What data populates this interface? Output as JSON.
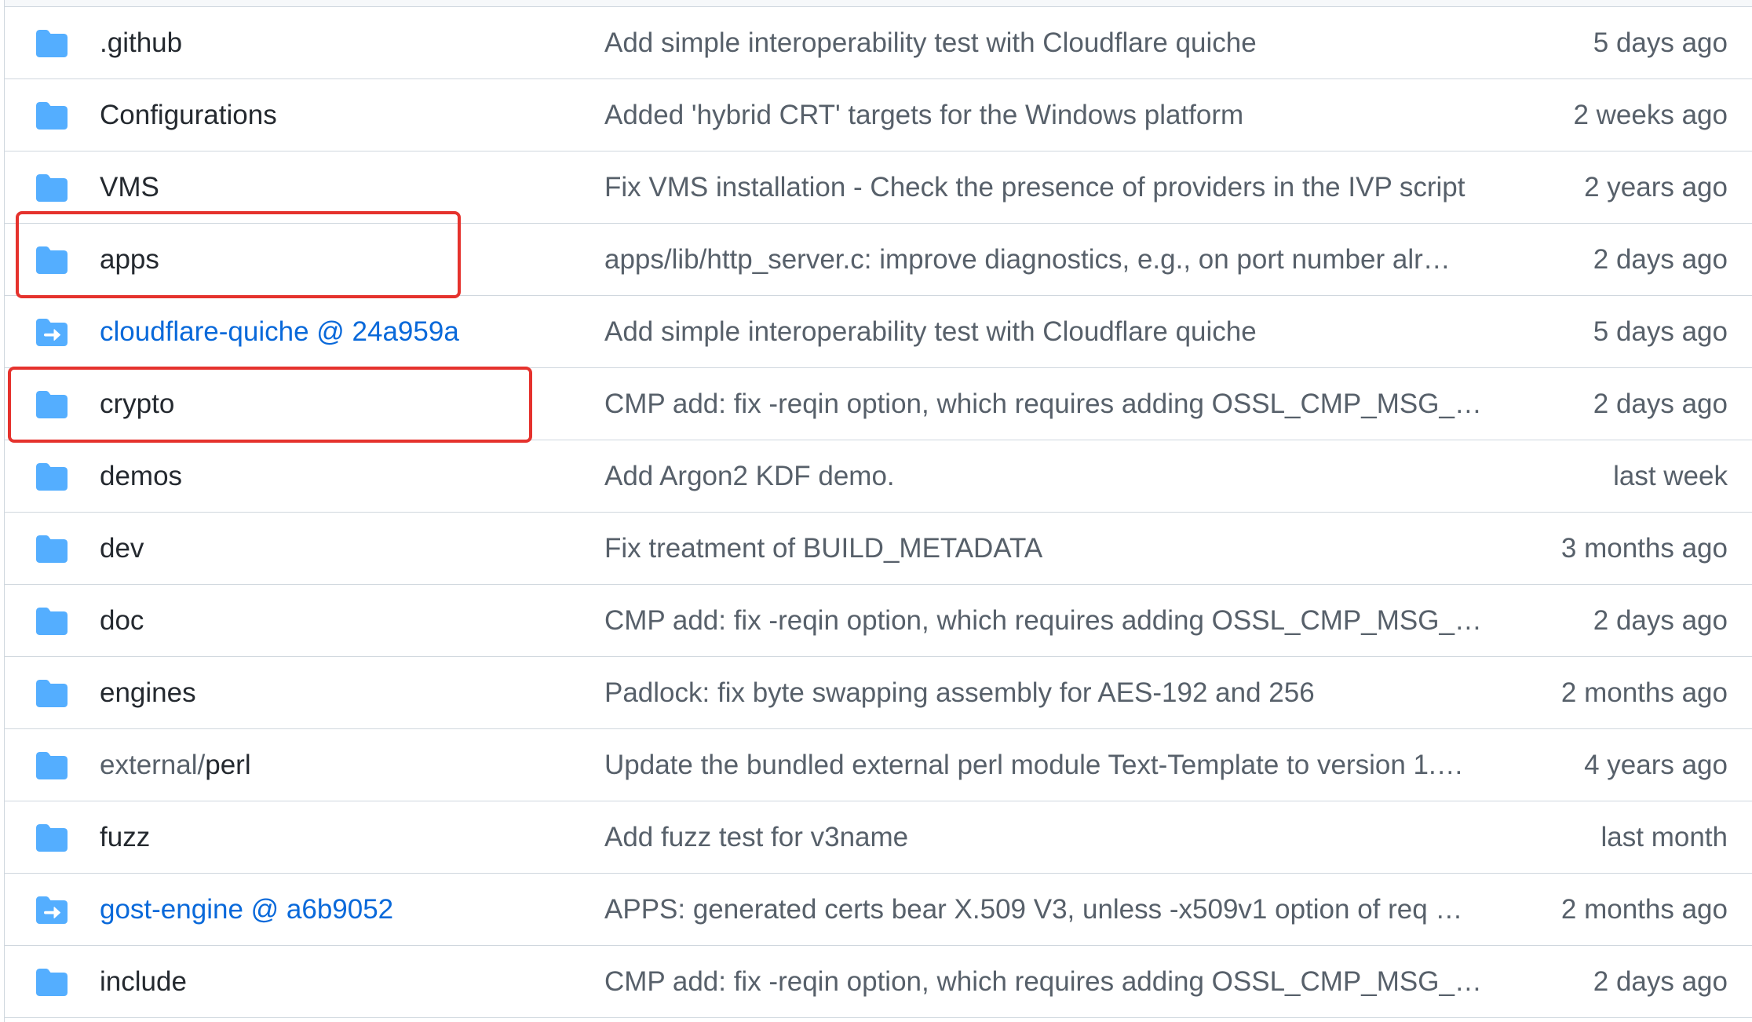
{
  "colors": {
    "folder_icon": "#54aeff",
    "file_name": "#24292f",
    "submodule_link": "#0969da",
    "secondary_text": "#57606a",
    "border": "#d0d7de",
    "highlight": "#e5322d"
  },
  "rows": [
    {
      "icon": "folder-icon",
      "name": ".github",
      "message": "Add simple interoperability test with Cloudflare quiche",
      "age": "5 days ago"
    },
    {
      "icon": "folder-icon",
      "name": "Configurations",
      "message": "Added 'hybrid CRT' targets for the Windows platform",
      "age": "2 weeks ago"
    },
    {
      "icon": "folder-icon",
      "name": "VMS",
      "message": "Fix VMS installation - Check the presence of providers in the IVP script",
      "age": "2 years ago"
    },
    {
      "icon": "folder-icon",
      "name": "apps",
      "message": "apps/lib/http_server.c: improve diagnostics, e.g., on port number alr…",
      "age": "2 days ago",
      "highlighted": true
    },
    {
      "icon": "submodule-icon",
      "name": "cloudflare-quiche @ 24a959a",
      "message": "Add simple interoperability test with Cloudflare quiche",
      "age": "5 days ago"
    },
    {
      "icon": "folder-icon",
      "name": "crypto",
      "message": "CMP add: fix -reqin option, which requires adding OSSL_CMP_MSG_…",
      "age": "2 days ago",
      "highlighted": true
    },
    {
      "icon": "folder-icon",
      "name": "demos",
      "message": "Add Argon2 KDF demo.",
      "age": "last week"
    },
    {
      "icon": "folder-icon",
      "name": "dev",
      "message": "Fix treatment of BUILD_METADATA",
      "age": "3 months ago"
    },
    {
      "icon": "folder-icon",
      "name": "doc",
      "message": "CMP add: fix -reqin option, which requires adding OSSL_CMP_MSG_…",
      "age": "2 days ago"
    },
    {
      "icon": "folder-icon",
      "name": "engines",
      "message": "Padlock: fix byte swapping assembly for AES-192 and 256",
      "age": "2 months ago"
    },
    {
      "icon": "folder-icon",
      "name_prefix": "external/",
      "name": "perl",
      "message": "Update the bundled external perl module Text-Template to version 1.…",
      "age": "4 years ago"
    },
    {
      "icon": "folder-icon",
      "name": "fuzz",
      "message": "Add fuzz test for v3name",
      "age": "last month"
    },
    {
      "icon": "submodule-icon",
      "name": "gost-engine @ a6b9052",
      "message": "APPS: generated certs bear X.509 V3, unless -x509v1 option of req …",
      "age": "2 months ago"
    },
    {
      "icon": "folder-icon",
      "name": "include",
      "message": "CMP add: fix -reqin option, which requires adding OSSL_CMP_MSG_…",
      "age": "2 days ago"
    }
  ]
}
